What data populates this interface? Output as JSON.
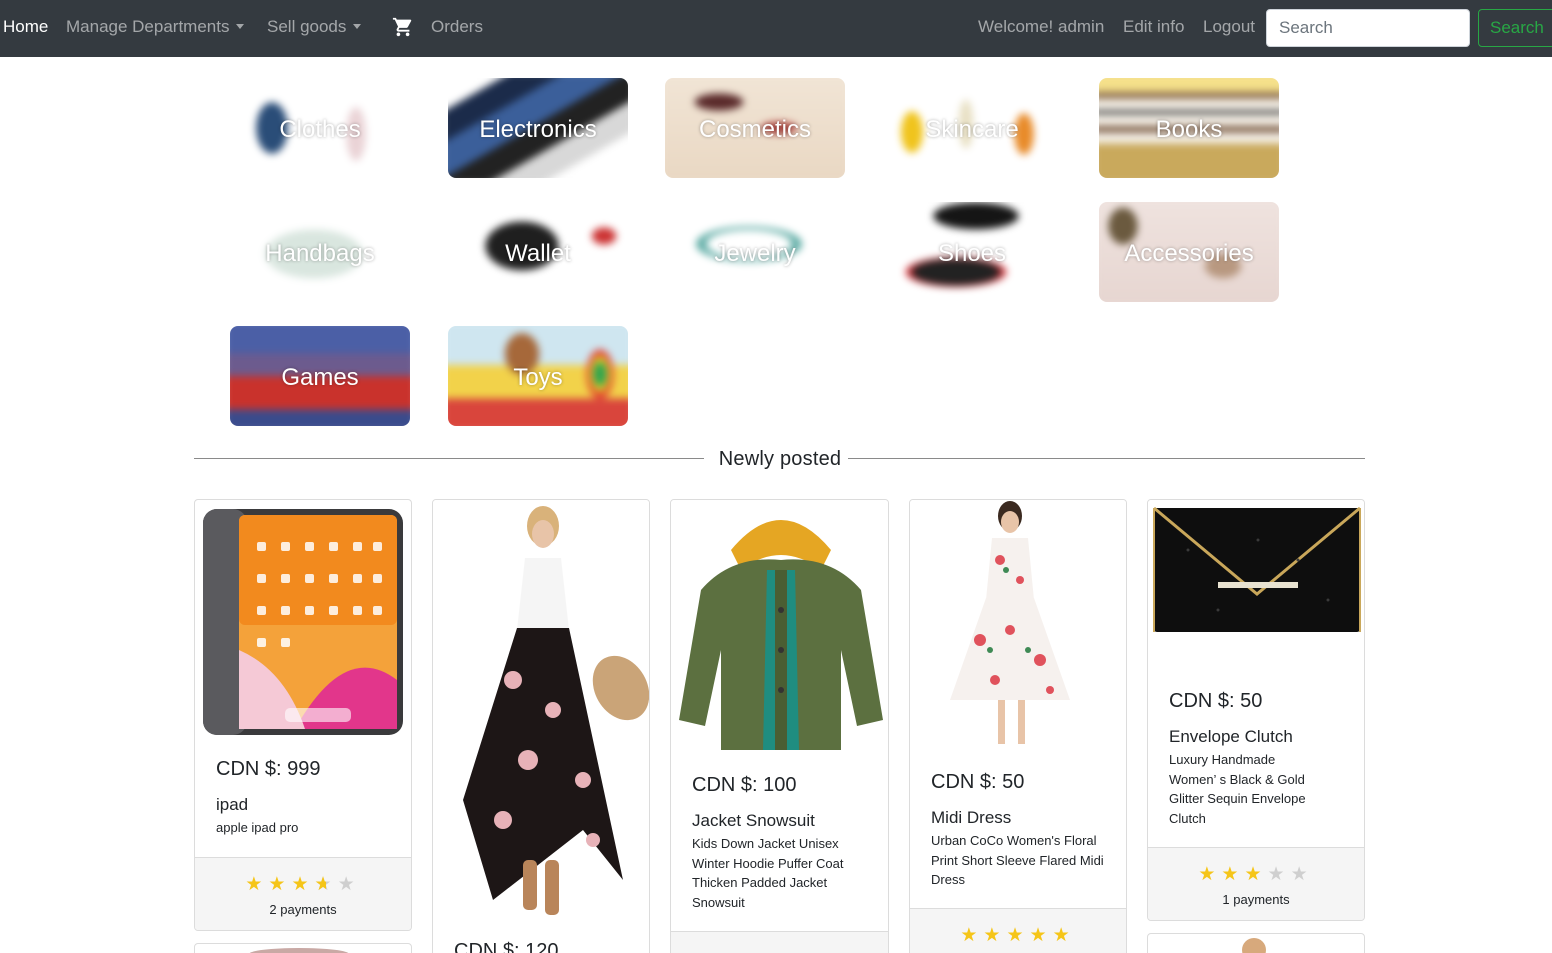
{
  "nav": {
    "home": "Home",
    "manage_departments": "Manage Departments",
    "sell_goods": "Sell goods",
    "cart_icon": "shopping-cart-icon",
    "orders": "Orders",
    "welcome": "Welcome! admin",
    "edit_info": "Edit info",
    "logout": "Logout",
    "search_placeholder": "Search",
    "search_button": "Search"
  },
  "categories": [
    {
      "label": "Clothes"
    },
    {
      "label": "Electronics"
    },
    {
      "label": "Cosmetics"
    },
    {
      "label": "Skincare"
    },
    {
      "label": "Books"
    },
    {
      "label": "Handbags"
    },
    {
      "label": "Wallet"
    },
    {
      "label": "Jewelry"
    },
    {
      "label": "Shoes"
    },
    {
      "label": "Accessories"
    },
    {
      "label": "Games"
    },
    {
      "label": "Toys"
    }
  ],
  "section_title": "Newly posted",
  "products": [
    {
      "price": "CDN $: 999",
      "name": "ipad",
      "desc": "apple ipad pro",
      "rating": 3.5,
      "payments": "2 payments"
    },
    {
      "price": "CDN $: 120",
      "name": "",
      "desc": "",
      "rating": null,
      "payments": ""
    },
    {
      "price": "CDN $: 100",
      "name": "Jacket Snowsuit",
      "desc": "Kids Down Jacket Unisex Winter Hoodie Puffer Coat Thicken Padded Jacket Snowsuit",
      "rating": null,
      "payments": ""
    },
    {
      "price": "CDN $: 50",
      "name": "Midi Dress",
      "desc": "Urban CoCo Women's Floral Print Short Sleeve Flared Midi Dress",
      "rating": 5,
      "payments": ""
    },
    {
      "price": "CDN $: 50",
      "name": "Envelope Clutch",
      "desc": "Luxury Handmade Women’ s Black & Gold Glitter Sequin Envelope Clutch",
      "rating": 3,
      "payments": "1 payments"
    }
  ],
  "colors": {
    "navbar": "#343a40",
    "success": "#28a745",
    "star": "#f5c518"
  }
}
